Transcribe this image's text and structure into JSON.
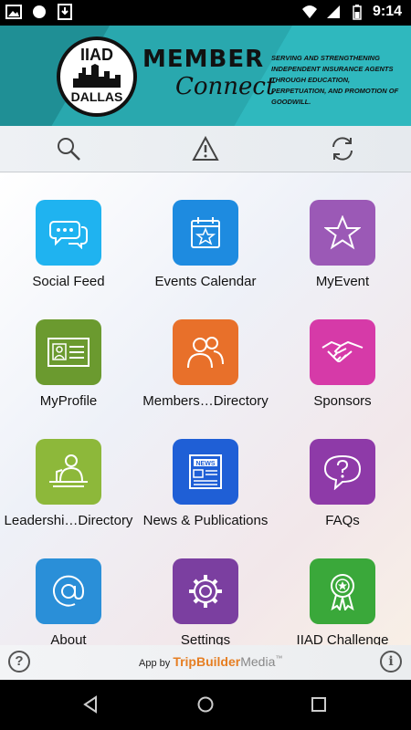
{
  "status_bar": {
    "time": "9:14",
    "left_icons": [
      "gallery-icon",
      "record-icon",
      "download-icon"
    ],
    "right_icons": [
      "wifi-icon",
      "signal-icon",
      "battery-icon"
    ]
  },
  "banner": {
    "logo_top": "IIAD",
    "logo_bottom": "DALLAS",
    "member": "MEMBER",
    "connect": "Connect",
    "tagline": "SERVING AND STRENGTHENING INDEPENDENT INSURANCE AGENTS THROUGH EDUCATION, PERPETUATION, AND PROMOTION OF GOODWILL.",
    "color": "#2fb8be"
  },
  "toolbar": {
    "buttons": [
      "search-icon",
      "alert-icon",
      "sync-icon"
    ]
  },
  "tiles": [
    {
      "label": "Social Feed",
      "color": "#1fb3f0",
      "icon": "chat-icon"
    },
    {
      "label": "Events Calendar",
      "color": "#1e8be0",
      "icon": "calendar-icon"
    },
    {
      "label": "MyEvent",
      "color": "#9b59b6",
      "icon": "star-icon"
    },
    {
      "label": "MyProfile",
      "color": "#6b9a2f",
      "icon": "id-card-icon"
    },
    {
      "label": "Members…Directory",
      "color": "#e8702a",
      "icon": "people-icon"
    },
    {
      "label": "Sponsors",
      "color": "#d63aa8",
      "icon": "handshake-icon"
    },
    {
      "label": "Leadershi…Directory",
      "color": "#8db83a",
      "icon": "podium-icon"
    },
    {
      "label": "News & Publications",
      "color": "#1f5fd6",
      "icon": "newspaper-icon"
    },
    {
      "label": "FAQs",
      "color": "#8e3aa8",
      "icon": "question-bubble-icon"
    },
    {
      "label": "About",
      "color": "#2a8fd8",
      "icon": "at-icon"
    },
    {
      "label": "Settings",
      "color": "#7b3fa0",
      "icon": "gear-icon"
    },
    {
      "label": "IIAD Challenge",
      "color": "#3aa83a",
      "icon": "award-icon"
    }
  ],
  "footer": {
    "help": "?",
    "info": "i",
    "app_by": "App by",
    "brand_a": "TripBuilder",
    "brand_b": "Media",
    "tm": "™"
  },
  "nav": [
    "back-icon",
    "home-icon",
    "recents-icon"
  ]
}
